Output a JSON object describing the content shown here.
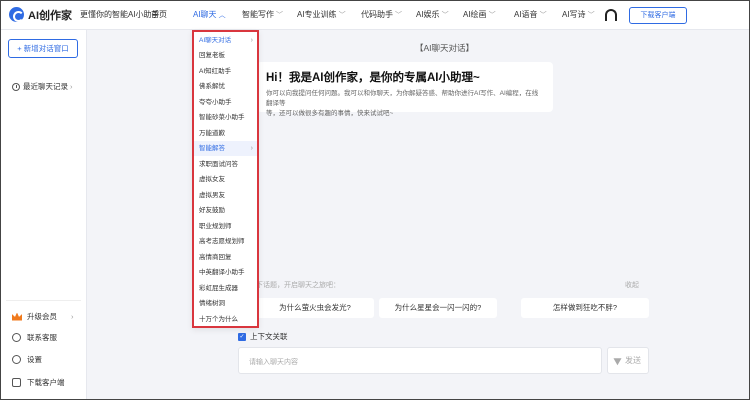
{
  "header": {
    "logo_text": "AI创作家",
    "slogan": "更懂你的智能AI小助手",
    "nav": [
      {
        "label": "首页",
        "chev": ""
      },
      {
        "label": "AI聊天",
        "chev": "︿"
      },
      {
        "label": "智能写作",
        "chev": "﹀"
      },
      {
        "label": "AI专业训练",
        "chev": "﹀"
      },
      {
        "label": "代码助手",
        "chev": "﹀"
      },
      {
        "label": "AI娱乐",
        "chev": "﹀"
      },
      {
        "label": "AI绘画",
        "chev": "﹀"
      },
      {
        "label": "AI语音",
        "chev": "﹀"
      },
      {
        "label": "AI写诗",
        "chev": "﹀"
      }
    ],
    "download_label": "下载客户端"
  },
  "sidebar": {
    "new_chat": "+ 新增对话窗口",
    "recent": "最近聊天记录",
    "recent_chev": "›",
    "bottom": [
      {
        "label": "升级会员",
        "chev": "›"
      },
      {
        "label": "联系客服"
      },
      {
        "label": "设置"
      },
      {
        "label": "下载客户端"
      }
    ]
  },
  "dropdown": {
    "items": [
      {
        "label": "AI聊天对话",
        "sub": "›"
      },
      {
        "label": "回复老板",
        "sub": ""
      },
      {
        "label": "AI知红助手",
        "sub": ""
      },
      {
        "label": "佛系解忧",
        "sub": ""
      },
      {
        "label": "夸夸小助手",
        "sub": ""
      },
      {
        "label": "智能砂菜小助手",
        "sub": ""
      },
      {
        "label": "万能道歉",
        "sub": ""
      },
      {
        "label": "智能解答",
        "sub": "›"
      },
      {
        "label": "求职面试问答",
        "sub": ""
      },
      {
        "label": "虚拟女友",
        "sub": ""
      },
      {
        "label": "虚拟男友",
        "sub": ""
      },
      {
        "label": "好友鼓励",
        "sub": ""
      },
      {
        "label": "职业规划师",
        "sub": ""
      },
      {
        "label": "高考志愿规划师",
        "sub": ""
      },
      {
        "label": "高情商回复",
        "sub": ""
      },
      {
        "label": "中英翻译小助手",
        "sub": ""
      },
      {
        "label": "彩虹屁生成器",
        "sub": ""
      },
      {
        "label": "情绪树洞",
        "sub": ""
      },
      {
        "label": "十万个为什么",
        "sub": ""
      }
    ]
  },
  "main": {
    "title": "【AI聊天对话】",
    "welcome_title": "Hi！我是AI创作家，是你的专属AI小助理~",
    "welcome_line1": "你可以向我提问任何问题。我可以和你聊天，为你解疑答惑、帮助你进行AI写作、AI编程，在线翻译等",
    "welcome_line2": "等，还可以做很多有趣的事情，快来试试吧~",
    "suggest_label": "下话题，开启聊天之旅吧：",
    "refresh": "收起",
    "suggestions": [
      "为什么萤火虫会发光?",
      "为什么星星会一闪一闪的?",
      "怎样做到狂吃不胖?"
    ],
    "context_label": "上下文关联",
    "check_mark": "✓",
    "input_placeholder": "请输入聊天内容",
    "send": "发送"
  }
}
